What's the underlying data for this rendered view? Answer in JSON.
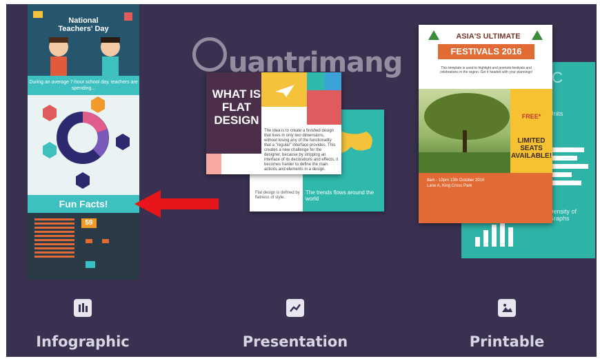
{
  "watermark": {
    "text": "uantrimang"
  },
  "cards": [
    {
      "id": "infographic",
      "label": "Infographic",
      "icon": "bar-chart-icon",
      "thumbnail": {
        "title_line1": "National",
        "title_line2": "Teachers' Day",
        "band_text": "During an average 7-hour school day, teachers are spending...",
        "fun_facts": "Fun Facts!",
        "badge_number": "59"
      }
    },
    {
      "id": "presentation",
      "label": "Presentation",
      "icon": "trend-chart-icon",
      "thumbnail": {
        "heading": "WHAT IS FLAT DESIGN",
        "body": "The idea is to create a finished design that lives in only two dimensions, without losing any of the functionality that a \"regular\" interface provides. This creates a new challenge for the designer, because by stripping an interface of its decorations and effects, it becomes harder to define the main actions and elements in a design.",
        "back_left": "Flat design is defined by flatness of style.",
        "back_right": "The trends flows around the world"
      }
    },
    {
      "id": "printable",
      "label": "Printable",
      "icon": "image-icon",
      "thumbnail": {
        "title": "ASIA'S ULTIMATE",
        "ribbon": "FESTIVALS 2016",
        "subtitle": "This template is used to highlight and promote festivals and celebrations in the region. Get it headed with your plannings!",
        "free": "FREE*",
        "limited": "LIMITED SEATS AVAILABLE!",
        "date": "8am - 10pm 13th October 2016 Lane A, King Cross Park",
        "back_title": "IC",
        "back_units": "Units",
        "back_density": "Density of Graphs"
      }
    }
  ]
}
